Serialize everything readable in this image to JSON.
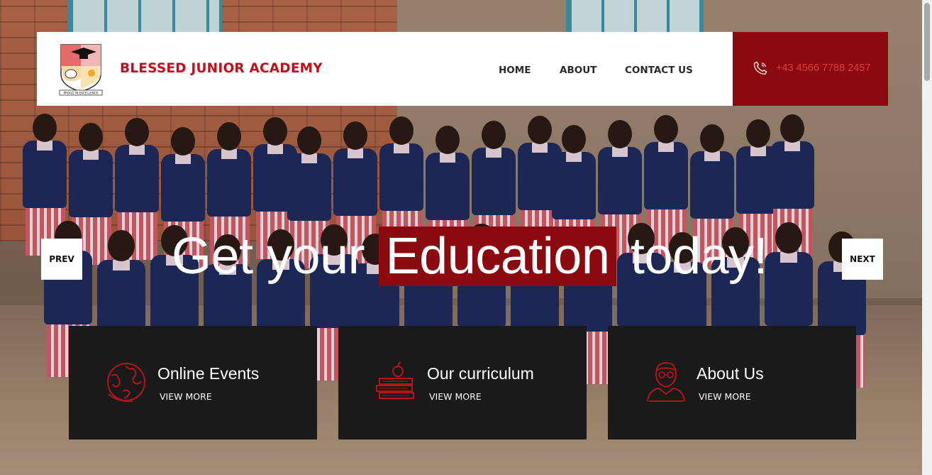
{
  "site": {
    "brand": "BLESSED JUNIOR ACADEMY",
    "logo_motto": "PROUD IN EXCELLENCE"
  },
  "nav": {
    "home": "HOME",
    "about": "ABOUT",
    "contact": "CONTACT US"
  },
  "contact": {
    "phone": "+43 4566 7788 2457",
    "phone_icon": "phone-icon"
  },
  "hero": {
    "headline_pre": "Get your",
    "headline_highlight": "Education",
    "headline_post": "today!",
    "prev_label": "PREV",
    "next_label": "NEXT"
  },
  "cards": [
    {
      "title": "Online Events",
      "more": "VIEW MORE",
      "icon": "globe-icon"
    },
    {
      "title": "Our curriculum",
      "more": "VIEW MORE",
      "icon": "books-apple-icon"
    },
    {
      "title": "About Us",
      "more": "VIEW MORE",
      "icon": "teacher-icon"
    }
  ],
  "colors": {
    "brand_red": "#c0101b",
    "accent_dark_red": "#8b0a0f",
    "card_bg": "#1a1a1a",
    "icon_red": "#b3141b"
  }
}
